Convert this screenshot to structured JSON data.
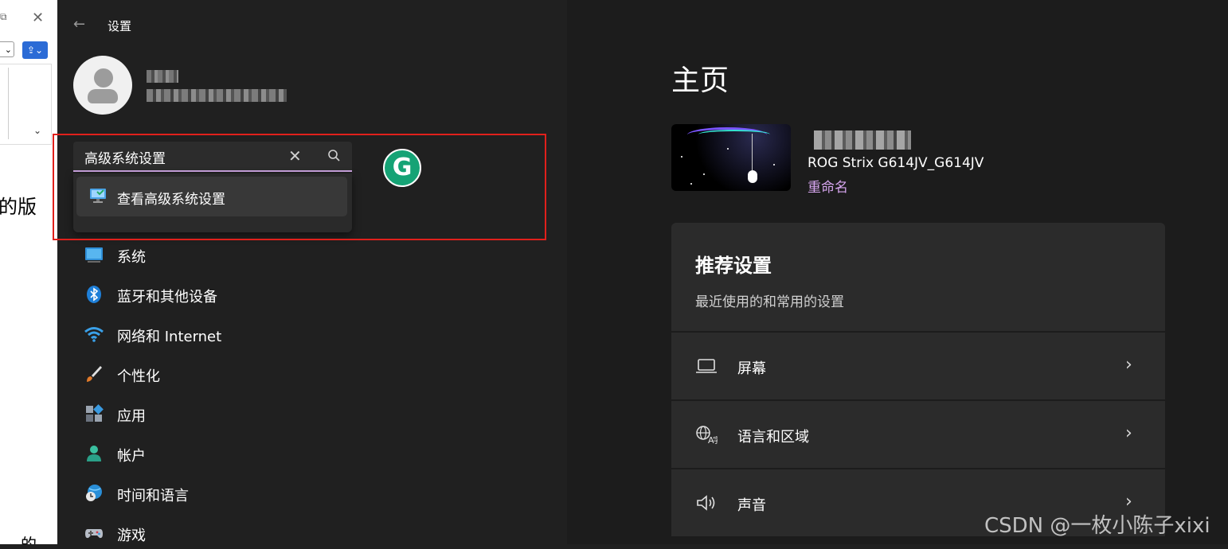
{
  "background_window": {
    "side_text": "的版",
    "side_text_bottom": "的"
  },
  "settings": {
    "title": "设置",
    "search": {
      "value": "高级系统设置",
      "suggestion": "查看高级系统设置"
    },
    "nav": [
      {
        "label": "系统",
        "icon": "monitor-icon"
      },
      {
        "label": "蓝牙和其他设备",
        "icon": "bluetooth-icon"
      },
      {
        "label": "网络和 Internet",
        "icon": "wifi-icon"
      },
      {
        "label": "个性化",
        "icon": "brush-icon"
      },
      {
        "label": "应用",
        "icon": "apps-icon"
      },
      {
        "label": "帐户",
        "icon": "account-icon"
      },
      {
        "label": "时间和语言",
        "icon": "clock-globe-icon"
      },
      {
        "label": "游戏",
        "icon": "gamepad-icon"
      }
    ],
    "home": {
      "title": "主页",
      "device_model": "ROG Strix G614JV_G614JV",
      "rename": "重命名",
      "recommended": {
        "title": "推荐设置",
        "subtitle": "最近使用的和常用的设置",
        "items": [
          {
            "label": "屏幕",
            "icon": "laptop-icon"
          },
          {
            "label": "语言和区域",
            "icon": "language-icon"
          },
          {
            "label": "声音",
            "icon": "speaker-icon"
          }
        ]
      }
    }
  },
  "grammarly": {
    "letter": "G"
  },
  "watermark": "CSDN @一枚小陈子xixi",
  "colors": {
    "accent": "#c9a3de",
    "highlight": "#e0201b",
    "background": "#202020",
    "card": "#2b2b2b"
  }
}
